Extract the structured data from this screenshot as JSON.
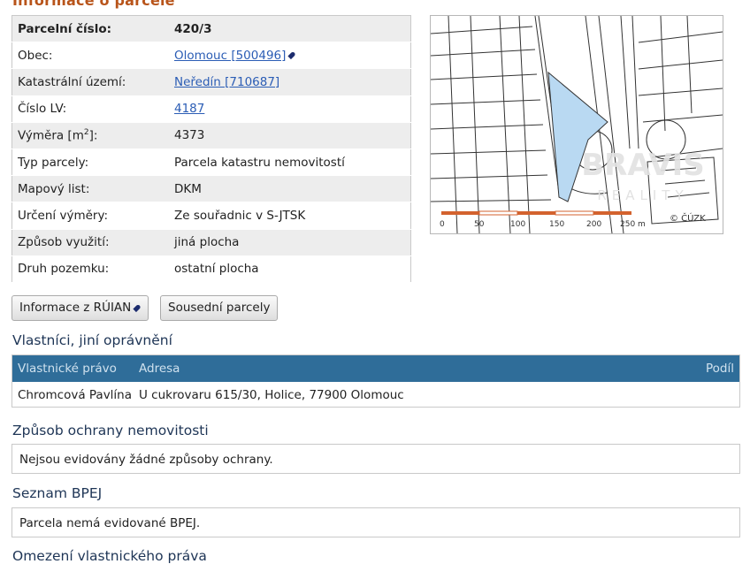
{
  "page_title": "Informace o parcele",
  "parcel_info": [
    {
      "label": "Parcelní číslo:",
      "value": "420/3",
      "link": false
    },
    {
      "label": "Obec:",
      "value": "Olomouc [500496]",
      "link": true,
      "icon": true
    },
    {
      "label": "Katastrální území:",
      "value": "Neředín [710687]",
      "link": true
    },
    {
      "label": "Číslo LV:",
      "value": "4187",
      "link": true
    },
    {
      "label_prefix": "Výměra [m",
      "label_sup": "2",
      "label_suffix": "]:",
      "value": "4373"
    },
    {
      "label": "Typ parcely:",
      "value": "Parcela katastru nemovitostí"
    },
    {
      "label": "Mapový list:",
      "value": "DKM"
    },
    {
      "label": "Určení výměry:",
      "value": "Ze souřadnic v S-JTSK"
    },
    {
      "label": "Způsob využití:",
      "value": "jiná plocha"
    },
    {
      "label": "Druh pozemku:",
      "value": "ostatní plocha"
    }
  ],
  "map": {
    "watermark": "BRAVIS",
    "watermark_sub": "REALITY",
    "copyright": "© ČÚZK",
    "scale_labels": [
      "0",
      "50",
      "100",
      "150",
      "200",
      "250 m"
    ],
    "parcel_color": "#b9d9f2"
  },
  "buttons": {
    "ruian": "Informace z RÚIAN",
    "neighbors": "Sousední parcely"
  },
  "owners": {
    "section_title": "Vlastníci, jiní oprávnění",
    "columns": [
      "Vlastnické právo",
      "Adresa",
      "Podíl"
    ],
    "rows": [
      {
        "name": "Chromcová Pavlína",
        "address": "U cukrovaru 615/30, Holice, 77900 Olomouc",
        "share": ""
      }
    ]
  },
  "protection": {
    "section_title": "Způsob ochrany nemovitosti",
    "text": "Nejsou evidovány žádné způsoby ochrany."
  },
  "bpej": {
    "section_title": "Seznam BPEJ",
    "text": "Parcela nemá evidované BPEJ."
  },
  "restrictions": {
    "section_title": "Omezení vlastnického práva"
  },
  "colors": {
    "title": "#b8541a",
    "section": "#1e3556",
    "header_bar": "#2f6d99",
    "link": "#2b5db5"
  }
}
